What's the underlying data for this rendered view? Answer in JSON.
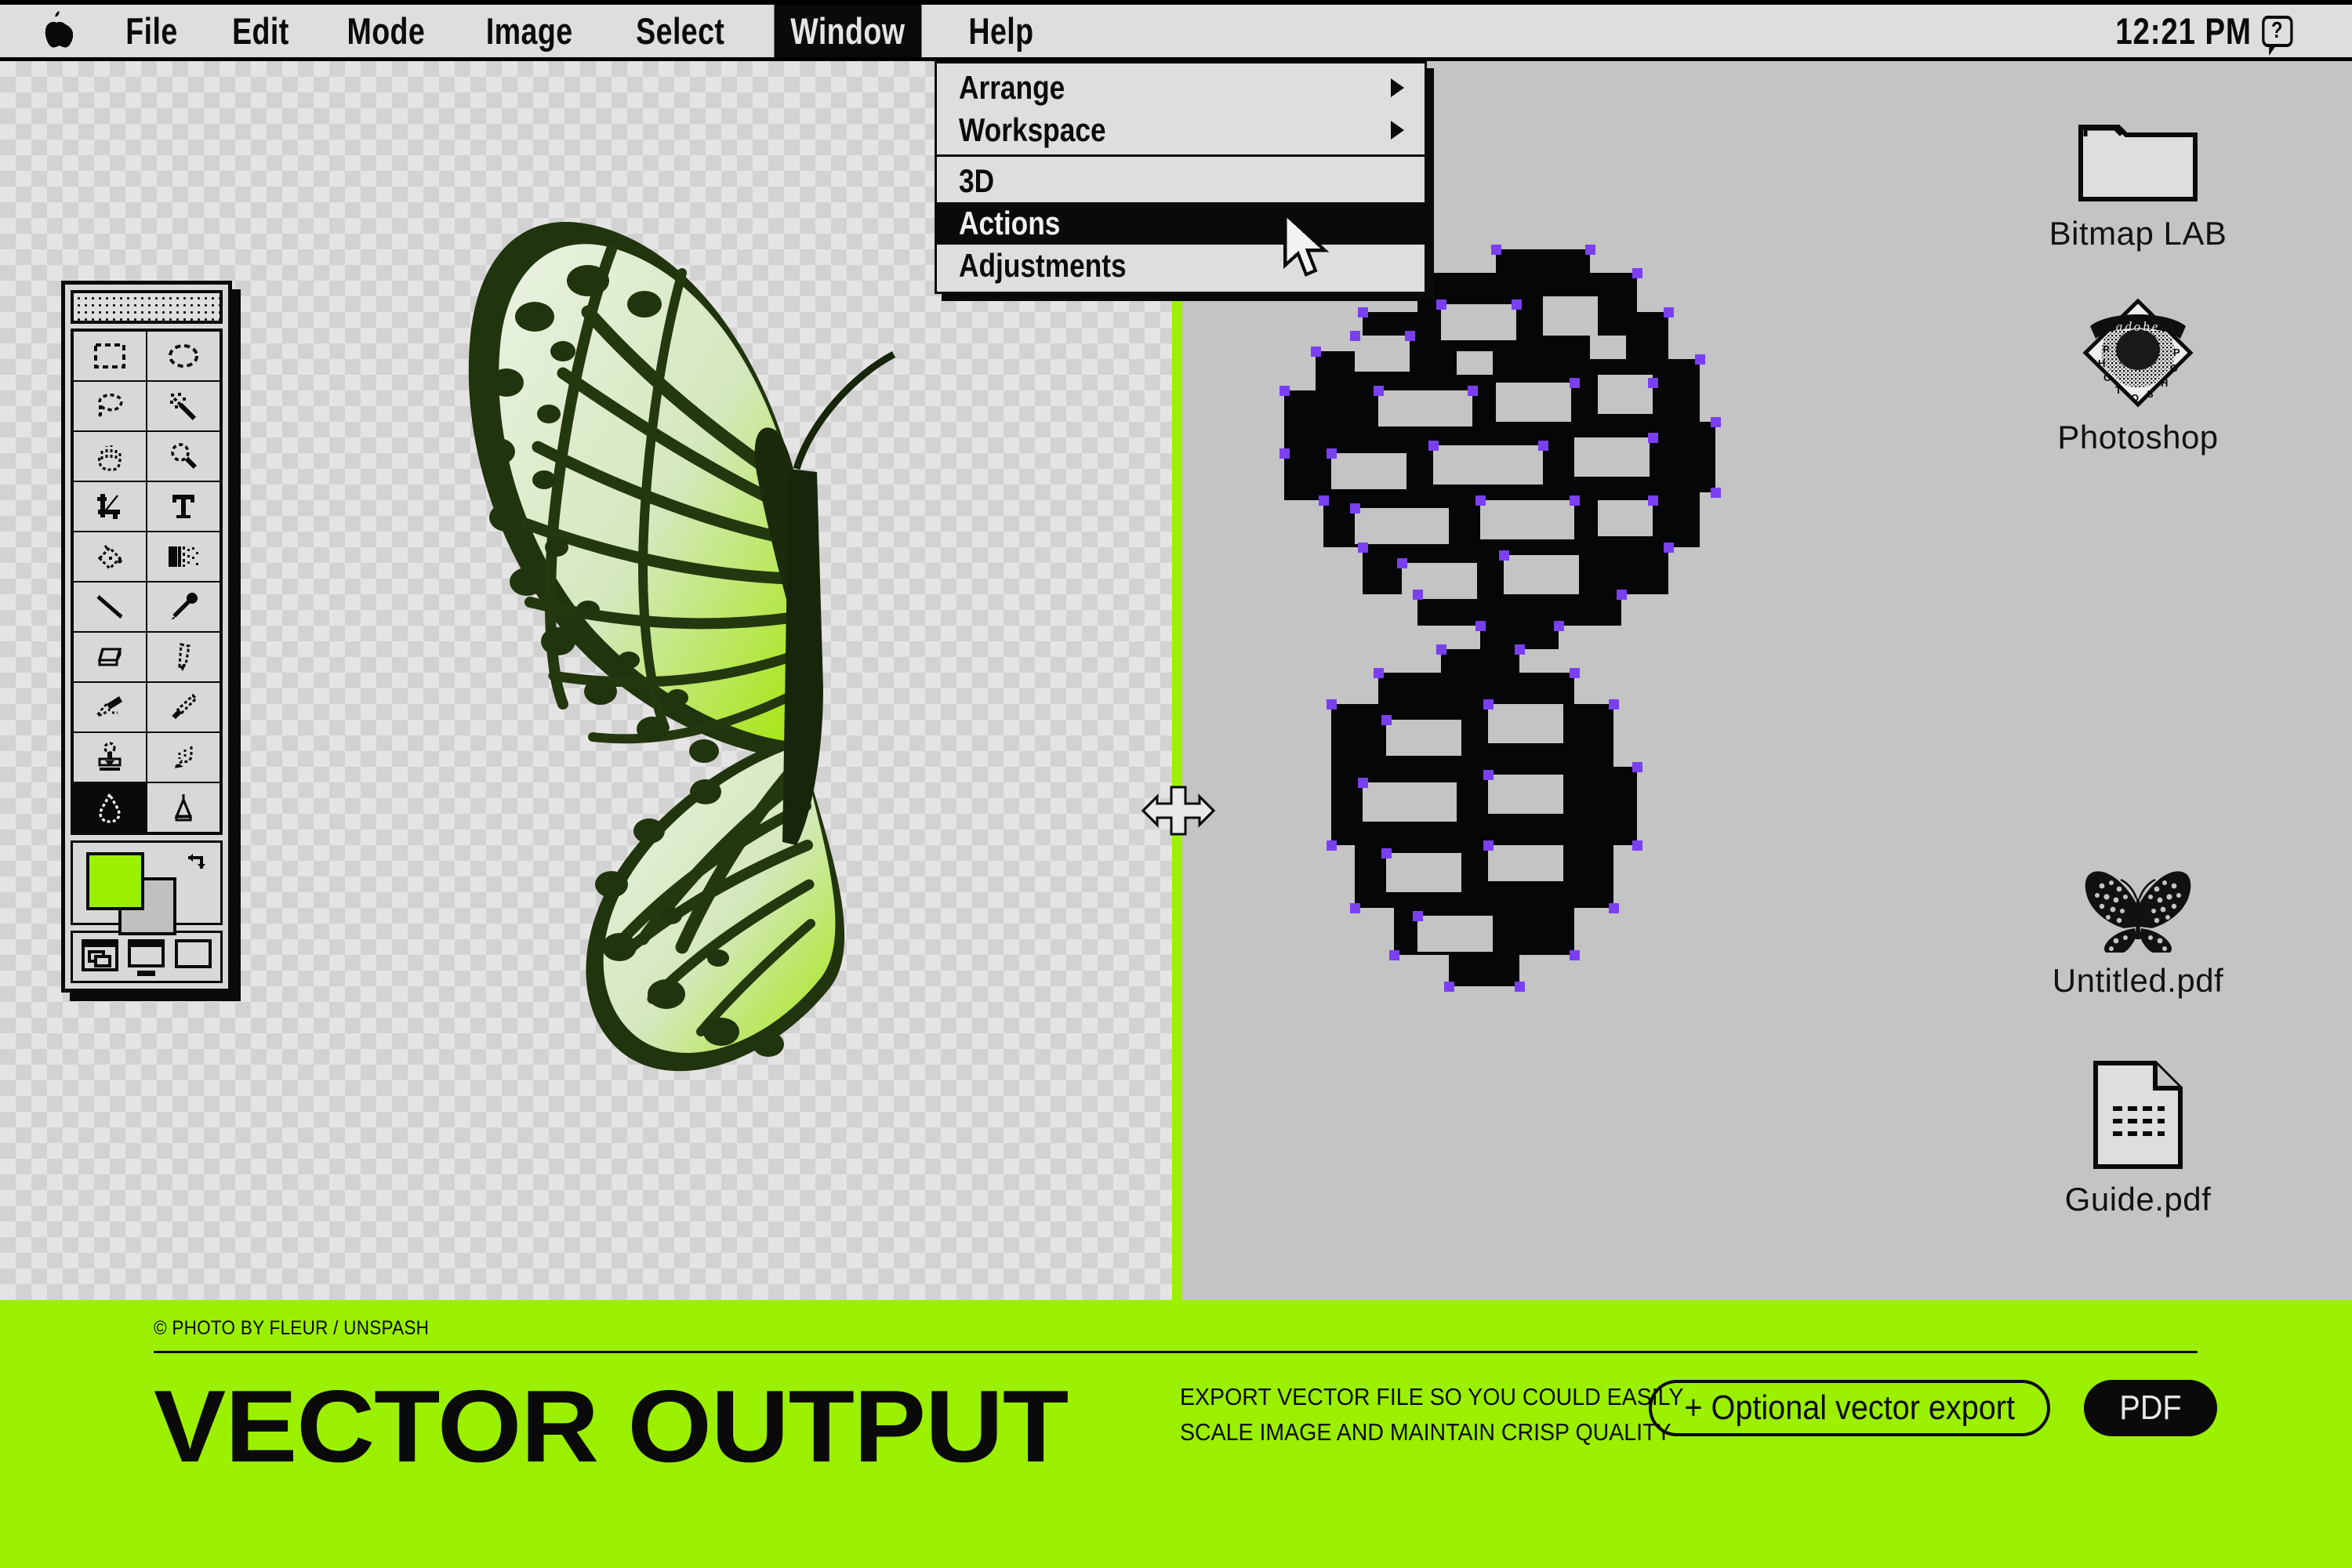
{
  "menubar": {
    "apple_icon": "apple-logo-icon",
    "items": [
      {
        "label": "File",
        "active": false
      },
      {
        "label": "Edit",
        "active": false
      },
      {
        "label": "Mode",
        "active": false
      },
      {
        "label": "Image",
        "active": false
      },
      {
        "label": "Select",
        "active": false
      },
      {
        "label": "Window",
        "active": true
      },
      {
        "label": "Help",
        "active": false
      }
    ],
    "clock": "12:21 PM",
    "help_icon": "help-balloon-icon",
    "help_glyph": "?"
  },
  "dropdown": {
    "owner": "Window",
    "items": [
      {
        "label": "Arrange",
        "submenu": true,
        "selected": false,
        "separator_after": false
      },
      {
        "label": "Workspace",
        "submenu": true,
        "selected": false,
        "separator_after": true
      },
      {
        "label": "3D",
        "submenu": false,
        "selected": false,
        "separator_after": false
      },
      {
        "label": "Actions",
        "submenu": false,
        "selected": true,
        "separator_after": false
      },
      {
        "label": "Adjustments",
        "submenu": false,
        "selected": false,
        "separator_after": false
      }
    ]
  },
  "toolbar": {
    "title": "tool-palette",
    "tools": [
      {
        "name": "rectangular-marquee-tool",
        "selected": false
      },
      {
        "name": "elliptical-marquee-tool",
        "selected": false
      },
      {
        "name": "lasso-tool",
        "selected": false
      },
      {
        "name": "magic-wand-tool",
        "selected": false
      },
      {
        "name": "hand-tool",
        "selected": false
      },
      {
        "name": "zoom-tool",
        "selected": false
      },
      {
        "name": "crop-tool",
        "selected": false
      },
      {
        "name": "type-tool",
        "selected": false
      },
      {
        "name": "paint-bucket-tool",
        "selected": false
      },
      {
        "name": "gradient-tool",
        "selected": false
      },
      {
        "name": "line-tool",
        "selected": false
      },
      {
        "name": "eyedropper-tool",
        "selected": false
      },
      {
        "name": "eraser-tool",
        "selected": false
      },
      {
        "name": "pencil-tool",
        "selected": false
      },
      {
        "name": "airbrush-tool",
        "selected": false
      },
      {
        "name": "paintbrush-tool",
        "selected": false
      },
      {
        "name": "clone-stamp-tool",
        "selected": false
      },
      {
        "name": "smudge-tool",
        "selected": false
      },
      {
        "name": "blur-tool",
        "selected": true
      },
      {
        "name": "dodge-burn-tool",
        "selected": false
      }
    ],
    "foreground_color": "#9bf000",
    "background_color": "#c0c0c0",
    "swap_icon": "swap-colors-icon",
    "screen_modes": [
      "standard-screen-mode",
      "full-screen-with-menubar-mode",
      "full-screen-mode"
    ]
  },
  "canvas": {
    "left_layer": "transparent-checkerboard-photo-layer",
    "right_layer": "bitmap-traced-vector-layer",
    "split_color": "#9bf000",
    "anchor_color": "#7b3ff2",
    "resize_cursor": "horizontal-resize-cursor"
  },
  "desktop_icons": [
    {
      "label": "Bitmap LAB",
      "icon": "folder-icon"
    },
    {
      "label": "Photoshop",
      "icon": "photoshop-app-icon"
    },
    {
      "label": "Untitled.pdf",
      "icon": "butterfly-thumbnail-icon"
    },
    {
      "label": "Guide.pdf",
      "icon": "document-icon"
    }
  ],
  "banner": {
    "credit": "© PHOTO BY FLEUR / UNSPASH",
    "headline": "VECTOR OUTPUT",
    "blurb_line1": "EXPORT VECTOR FILE SO YOU COULD EASILY",
    "blurb_line2": "SCALE IMAGE AND MAINTAIN CRISP QUALITY",
    "pill_outline": "+ Optional vector export",
    "pill_filled": "PDF",
    "accent_color": "#9bf000"
  }
}
